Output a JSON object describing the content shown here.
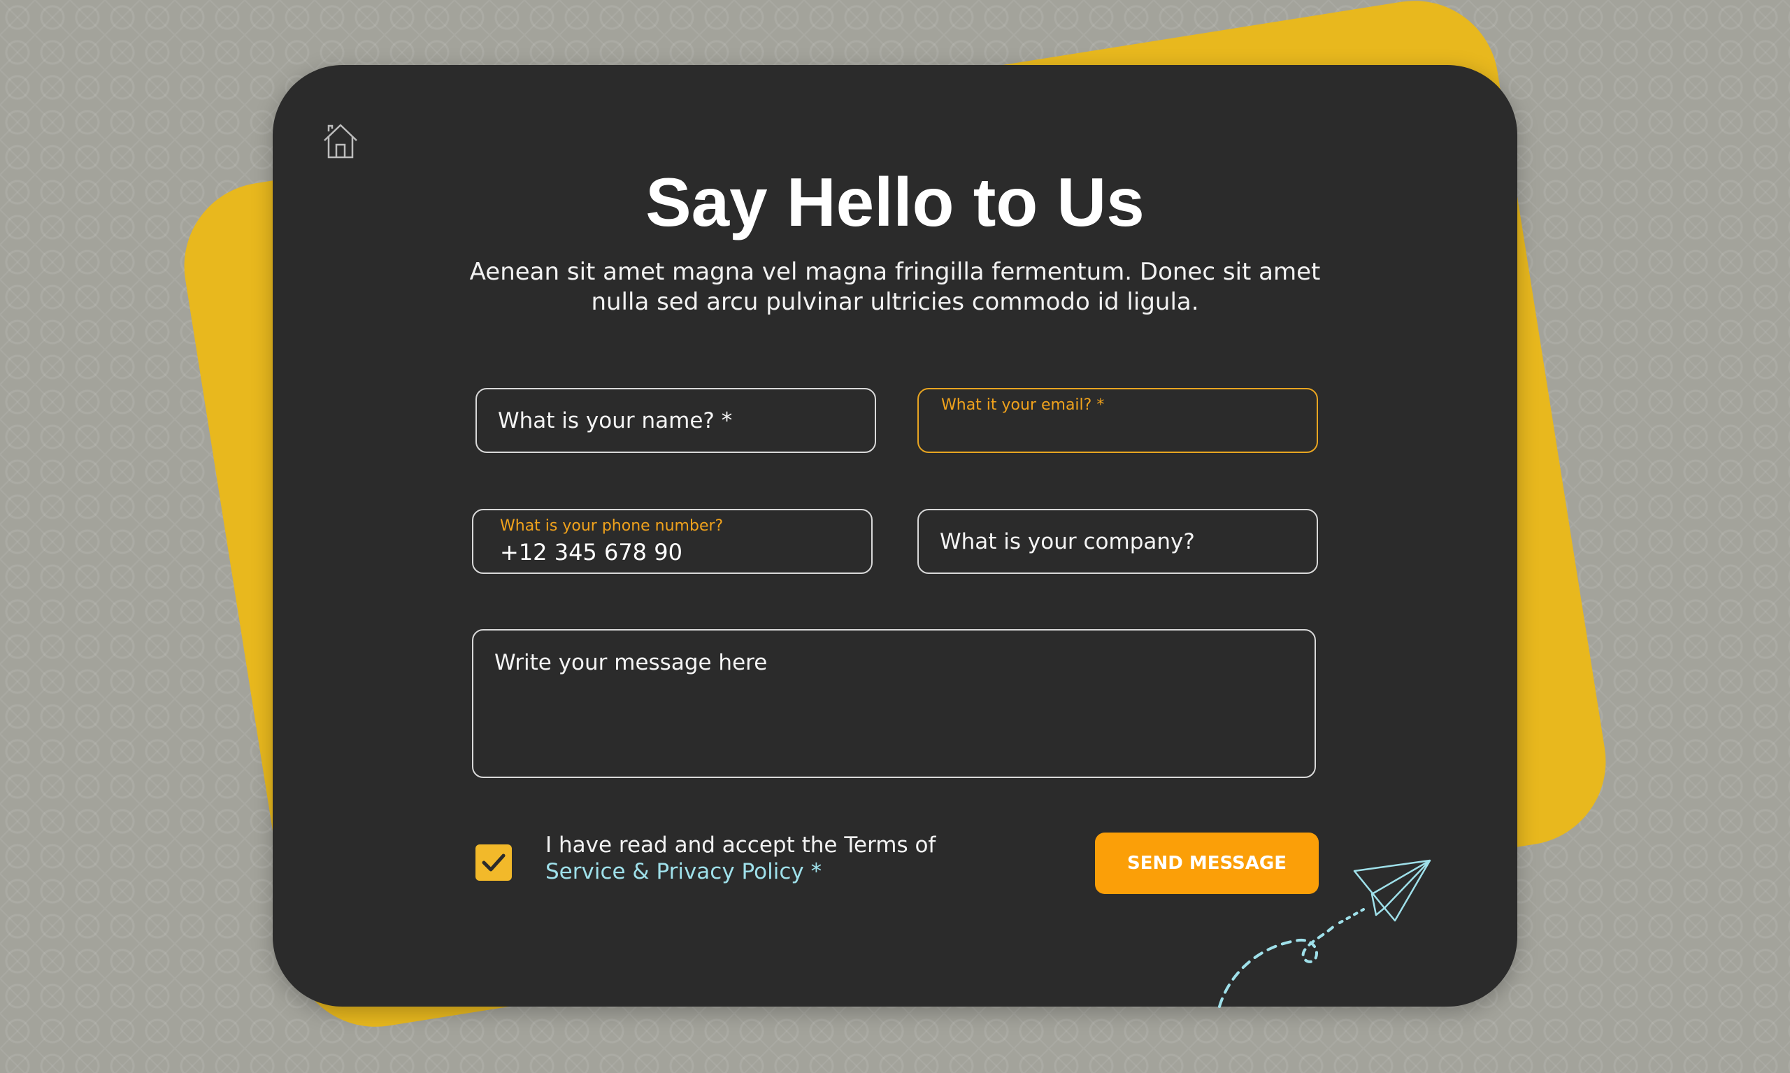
{
  "header": {
    "title": "Say Hello to Us",
    "subtitle_line1": "Aenean sit amet magna vel magna fringilla fermentum. Donec sit amet",
    "subtitle_line2": "nulla sed arcu pulvinar ultricies commodo id ligula."
  },
  "form": {
    "name": {
      "placeholder": "What is your name? *"
    },
    "email": {
      "label": "What it your email? *",
      "value": ""
    },
    "phone": {
      "label": "What is your phone number?",
      "value": "+12 345 678 90"
    },
    "company": {
      "placeholder": "What is your company?"
    },
    "message": {
      "placeholder": "Write your message here"
    },
    "terms": {
      "checked": true,
      "text": "I have read and accept the Terms of",
      "link": "Service & Privacy Policy *"
    },
    "submit_label": "SEND MESSAGE"
  },
  "icons": {
    "home": "home-icon",
    "check": "check-icon",
    "plane": "paper-plane-icon"
  },
  "colors": {
    "background": "#a3a39b",
    "accent_yellow": "#e8b81e",
    "card": "#2b2b2b",
    "button": "#fb9f08",
    "label_orange": "#f0a21c",
    "link_cyan": "#9fe0ea"
  }
}
